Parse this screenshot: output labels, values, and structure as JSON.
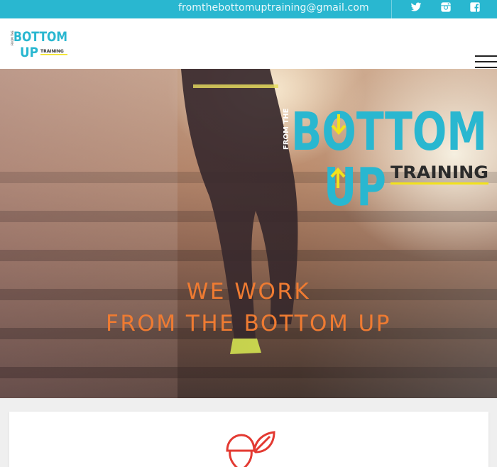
{
  "topbar": {
    "email": "fromthebottomuptraining@gmail.com",
    "social": [
      "twitter-icon",
      "instagram-icon",
      "facebook-icon"
    ],
    "background": "#29b7d0"
  },
  "brand": {
    "logo_from_the": "FROM THE",
    "logo_bottom": "BOTTOM",
    "logo_up": "UP",
    "logo_training": "TRAINING",
    "primary_blue": "#29b7d0",
    "accent_yellow": "#f2e21c"
  },
  "hero": {
    "title_line1": "WE WORK",
    "title_line2": "FROM THE BOTTOM UP",
    "title_color": "#ef7b32"
  },
  "card": {
    "icon": "acorn-leaf-icon",
    "icon_color": "#e33a32"
  }
}
